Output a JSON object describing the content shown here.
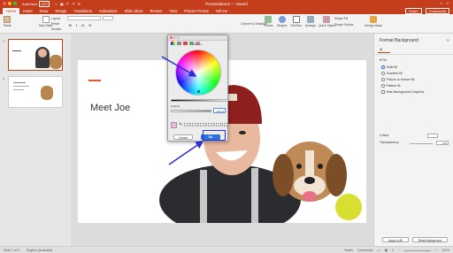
{
  "window": {
    "autosave_label": "AutoSave",
    "autosave_state": "OFF",
    "title": "Presentation2 — Saved"
  },
  "ribbon": {
    "tabs": [
      "Home",
      "Insert",
      "Draw",
      "Design",
      "Transitions",
      "Animations",
      "Slide Show",
      "Review",
      "View",
      "Picture Format",
      "Tell me"
    ],
    "active_tab": "Home",
    "share_label": "Share",
    "comments_label": "Comments",
    "paste_label": "Paste",
    "new_slide_label": "New Slide",
    "layout_label": "Layout",
    "reset_label": "Reset",
    "section_label": "Section",
    "convert_label": "Convert to SmartArt",
    "picture_label": "Picture",
    "shapes_label": "Shapes",
    "text_box_label": "Text Box",
    "arrange_label": "Arrange",
    "quick_styles_label": "Quick Styles",
    "shape_fill_label": "Shape Fill",
    "shape_outline_label": "Shape Outline",
    "design_ideas_label": "Design Ideas",
    "accent_color": "#c43e1c"
  },
  "thumbnails": [
    {
      "number": "1",
      "selected": true
    },
    {
      "number": "2",
      "selected": false
    }
  ],
  "slide": {
    "title": "Meet Joe"
  },
  "color_dialog": {
    "colours_label": "Colours",
    "opacity_label": "Opacity",
    "opacity_value": "100 %",
    "cancel_label": "Cancel",
    "ok_label": "OK",
    "current_color": "#f4b6e0"
  },
  "format_pane": {
    "title": "Format Background",
    "tab_label": "Fill",
    "fill_section": "Fill",
    "options": [
      {
        "label": "Solid fill",
        "selected": true
      },
      {
        "label": "Gradient fill",
        "selected": false
      },
      {
        "label": "Picture or texture fill",
        "selected": false
      },
      {
        "label": "Pattern fill",
        "selected": false
      }
    ],
    "hide_graphics_label": "Hide Background Graphics",
    "colour_label": "Colour",
    "transparency_label": "Transparency",
    "transparency_value": "0%",
    "apply_all_label": "Apply to All",
    "reset_bg_label": "Reset Background"
  },
  "statusbar": {
    "slide_info": "Slide 1 of 2",
    "language": "English (Australia)",
    "notes_label": "Notes",
    "comments_label": "Comments",
    "zoom": "111%"
  }
}
